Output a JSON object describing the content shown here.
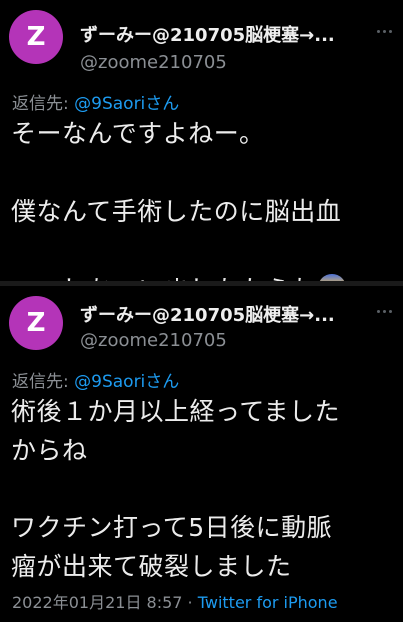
{
  "tweets": [
    {
      "avatar_letter": "Z",
      "display_name": "ずーみー@210705脳梗塞→...",
      "handle": "@zoome210705",
      "reply_prefix": "返信先: ",
      "reply_to": "@9Saoriさん",
      "line1": "そーなんですよねー。",
      "line2": "僕なんて手術したのに脳出血",
      "line3": "しちゃいましたからね",
      "emoji": "disappointed-relieved-face"
    },
    {
      "avatar_letter": "Z",
      "display_name": "ずーみー@210705脳梗塞→...",
      "handle": "@zoome210705",
      "reply_prefix": "返信先: ",
      "reply_to": "@9Saoriさん",
      "line1": "術後１か月以上経ってました",
      "line2": "からね",
      "line3": "ワクチン打って5日後に動脈",
      "line4": "瘤が出来て破裂しました"
    }
  ],
  "footer": {
    "timestamp": "2022年01月21日 8:57",
    "separator": " · ",
    "source": "Twitter for iPhone"
  },
  "colors": {
    "background": "#000000",
    "avatar": "#b434b8",
    "link": "#1d9bf0",
    "muted": "#8b8f94",
    "text": "#ececec"
  }
}
